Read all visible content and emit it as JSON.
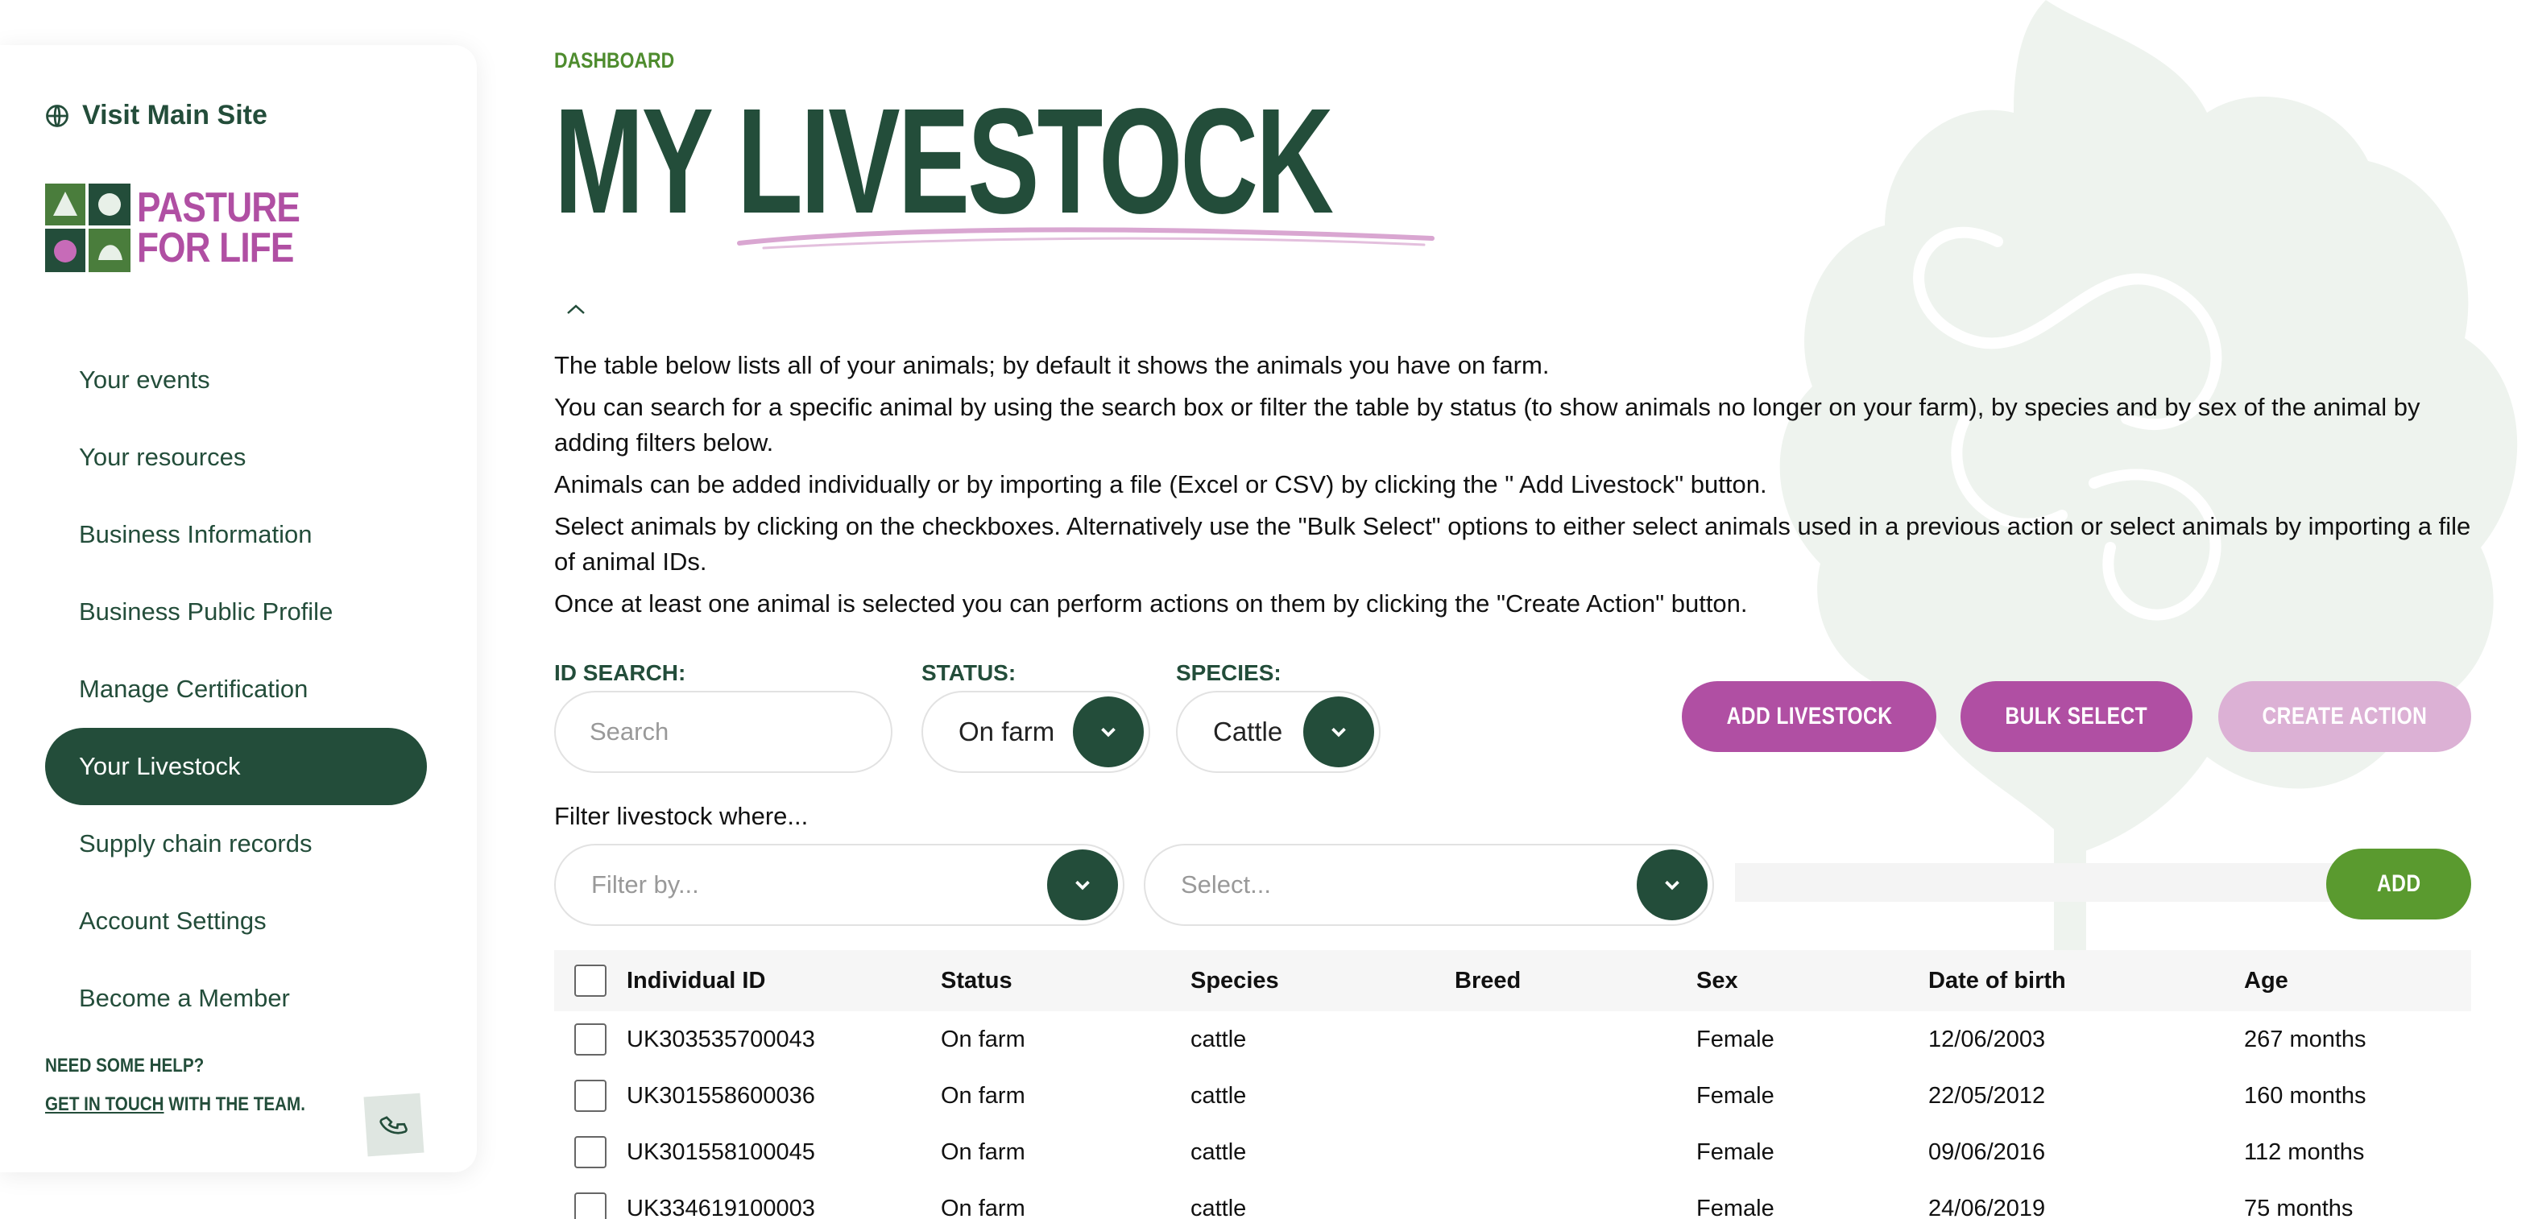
{
  "sidebar": {
    "visit_site": "Visit Main Site",
    "logo": {
      "line1": "PASTURE",
      "line2": "FOR LIFE"
    },
    "nav": [
      {
        "label": "Your events",
        "active": false
      },
      {
        "label": "Your resources",
        "active": false
      },
      {
        "label": "Business Information",
        "active": false
      },
      {
        "label": "Business Public Profile",
        "active": false
      },
      {
        "label": "Manage Certification",
        "active": false
      },
      {
        "label": "Your Livestock",
        "active": true
      },
      {
        "label": "Supply chain records",
        "active": false
      },
      {
        "label": "Account Settings",
        "active": false
      },
      {
        "label": "Become a Member",
        "active": false
      }
    ],
    "help": {
      "line1": "NEED SOME HELP?",
      "link": "GET IN TOUCH",
      "line2_rest": " WITH THE TEAM."
    }
  },
  "header": {
    "breadcrumb": "DASHBOARD",
    "title": "MY LIVESTOCK"
  },
  "intro": [
    "The table below lists all of your animals; by default it shows the animals you have on farm.",
    "You can search for a specific animal by using the search box or filter the table by status (to show animals no longer on your farm), by species and by sex of the animal by adding filters below.",
    "Animals can be added individually or by importing a file (Excel or CSV) by clicking the \" Add Livestock\" button.",
    "Select animals by clicking on the checkboxes. Alternatively use the \"Bulk Select\" options to either select animals used in a previous action or select animals by importing a file of animal IDs.",
    "Once at least one animal is selected you can perform actions on them by clicking the \"Create Action\" button."
  ],
  "filters": {
    "id_search_label": "ID SEARCH:",
    "id_search_placeholder": "Search",
    "status_label": "STATUS:",
    "status_value": "On farm",
    "species_label": "SPECIES:",
    "species_value": "Cattle",
    "filter_where": "Filter livestock where...",
    "filter_by_placeholder": "Filter by...",
    "select_placeholder": "Select..."
  },
  "buttons": {
    "add_livestock": "ADD LIVESTOCK",
    "bulk_select": "BULK SELECT",
    "create_action": "CREATE ACTION",
    "add": "ADD"
  },
  "table": {
    "columns": [
      "Individual ID",
      "Status",
      "Species",
      "Breed",
      "Sex",
      "Date of birth",
      "Age"
    ],
    "rows": [
      [
        "UK303535700043",
        "On farm",
        "cattle",
        "",
        "Female",
        "12/06/2003",
        "267 months"
      ],
      [
        "UK301558600036",
        "On farm",
        "cattle",
        "",
        "Female",
        "22/05/2012",
        "160 months"
      ],
      [
        "UK301558100045",
        "On farm",
        "cattle",
        "",
        "Female",
        "09/06/2016",
        "112 months"
      ],
      [
        "UK334619100003",
        "On farm",
        "cattle",
        "",
        "Female",
        "24/06/2019",
        "75 months"
      ]
    ]
  },
  "colors": {
    "dark_green": "#234d3a",
    "pink": "#b04fa3",
    "pink_disabled": "#dcb1d5",
    "lime": "#5a9a2f",
    "crumb_green": "#4e8c2e"
  }
}
